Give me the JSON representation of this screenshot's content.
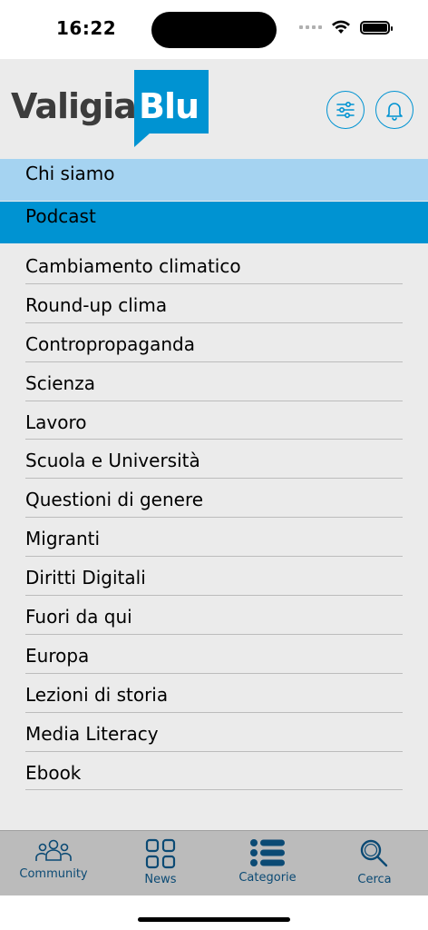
{
  "status_bar": {
    "time": "16:22"
  },
  "logo": {
    "part1": "Valigia",
    "part2": "Blu"
  },
  "header": {
    "filter_icon": "sliders-icon",
    "bell_icon": "bell-icon"
  },
  "menu": {
    "chi_siamo": "Chi siamo",
    "podcast": "Podcast"
  },
  "categories": [
    "Cambiamento climatico",
    "Round-up clima",
    "Contropropaganda",
    "Scienza",
    "Lavoro",
    "Scuola e Università",
    "Questioni di genere",
    "Migranti",
    "Diritti Digitali",
    "Fuori da qui",
    "Europa",
    "Lezioni di storia",
    "Media Literacy",
    "Ebook"
  ],
  "tabs": [
    {
      "label": "Community",
      "icon": "people-icon"
    },
    {
      "label": "News",
      "icon": "grid-icon"
    },
    {
      "label": "Categorie",
      "icon": "list-icon"
    },
    {
      "label": "Cerca",
      "icon": "search-icon"
    }
  ],
  "colors": {
    "brand": "#0093d2",
    "brand_light": "#a5d3f1",
    "tab_text": "#0b4a74"
  }
}
